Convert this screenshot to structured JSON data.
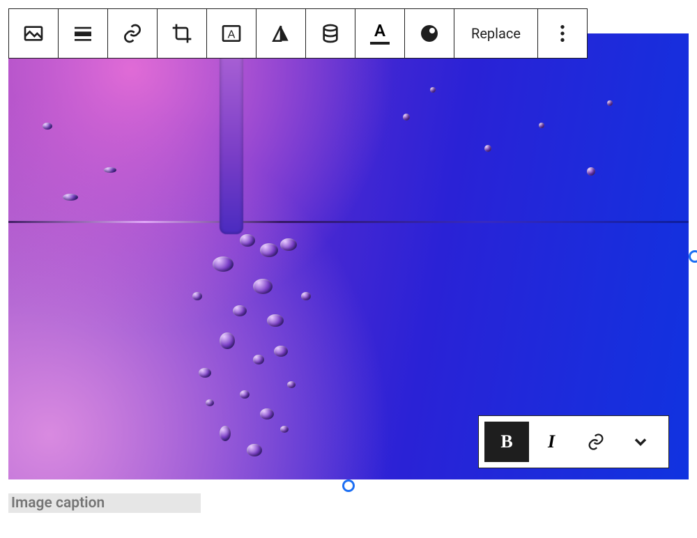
{
  "toolbar": {
    "image_block": "Image block",
    "align": "Change alignment",
    "link": "Insert link",
    "crop": "Crop",
    "text_overlay": "Add text over image",
    "duotone": "Apply duotone filter",
    "stack": "Aspect ratio",
    "typography": "Typography",
    "styles": "Styles",
    "replace_label": "Replace",
    "more": "More options"
  },
  "inline_toolbar": {
    "bold_label": "B",
    "italic_label": "I",
    "link": "Link",
    "more": "More"
  },
  "caption": {
    "placeholder": "Image caption"
  },
  "image": {
    "alt": "Purple and blue water with bubbles"
  }
}
